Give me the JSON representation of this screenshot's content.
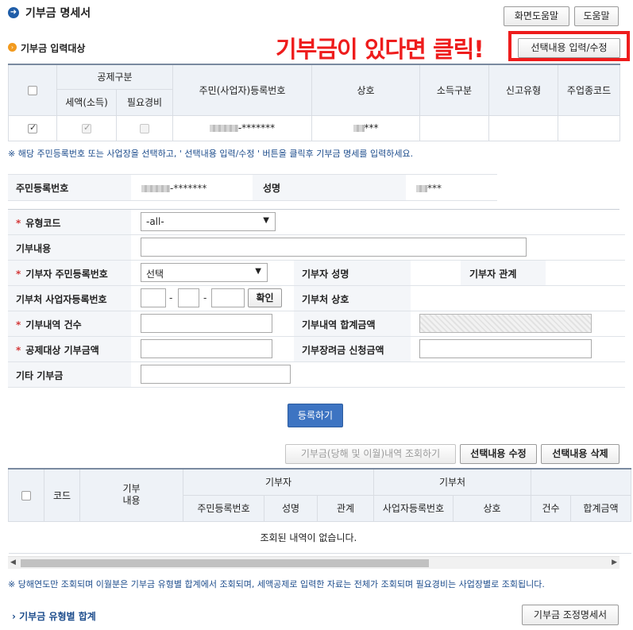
{
  "header": {
    "title": "기부금 명세서",
    "screen_help": "화면도움말",
    "help": "도움말"
  },
  "section1": {
    "title": "기부금 입력대상",
    "select_input_button": "선택내용 입력/수정"
  },
  "callout_text": "기부금이 있다면 클릭!",
  "target_table": {
    "headers": {
      "deduction_type": "공제구분",
      "tax_credit": "세액(소득)",
      "necessary_expense": "필요경비",
      "reg_no": "주민(사업자)등록번호",
      "name": "상호",
      "income_type": "소득구분",
      "report_type": "신고유형",
      "industry_code": "주업종코드"
    },
    "row": {
      "reg_no_suffix": "-*******",
      "name_suffix": "***"
    }
  },
  "note1": "※ 해당 주민등록번호 또는 사업장을 선택하고, ' 선택내용 입력/수정 ' 버튼을 클릭후 기부금 명세를 입력하세요.",
  "person": {
    "reg_label": "주민등록번호",
    "reg_suffix": "-*******",
    "name_label": "성명",
    "name_suffix": "***"
  },
  "form": {
    "type_code_label": "유형코드",
    "type_code_value": "-all-",
    "content_label": "기부내용",
    "donor_reg_label": "기부자 주민등록번호",
    "donor_reg_value": "선택",
    "donor_name_label": "기부자 성명",
    "donor_relation_label": "기부자 관계",
    "recipient_biz_label": "기부처 사업자등록번호",
    "confirm_button": "확인",
    "recipient_name_label": "기부처 상호",
    "count_label": "기부내역 건수",
    "total_label": "기부내역 합계금액",
    "deductible_label": "공제대상 기부금액",
    "incentive_label": "기부장려금 신청금액",
    "other_label": "기타 기부금"
  },
  "register_button": "등록하기",
  "list_buttons": {
    "query": "기부금(당해 및 이월)내역 조회하기",
    "edit": "선택내용 수정",
    "delete": "선택내용 삭제"
  },
  "list_table": {
    "code": "코드",
    "content_1": "기부",
    "content_2": "내용",
    "donor": "기부자",
    "recipient": "기부처",
    "donor_reg": "주민등록번호",
    "donor_name": "성명",
    "donor_relation": "관계",
    "recipient_biz": "사업자등록번호",
    "recipient_name": "상호",
    "count": "건수",
    "total": "합계금액",
    "empty": "조회된 내역이 없습니다."
  },
  "note2": "※ 당해연도만 조회되며 이월분은 기부금 유형별 합계에서 조회되며, 세액공제로 입력한 자료는 전체가 조회되며 필요경비는 사업장별로 조회됩니다.",
  "summary": {
    "title": "기부금 유형별 합계",
    "adjust_button": "기부금 조정명세서"
  }
}
